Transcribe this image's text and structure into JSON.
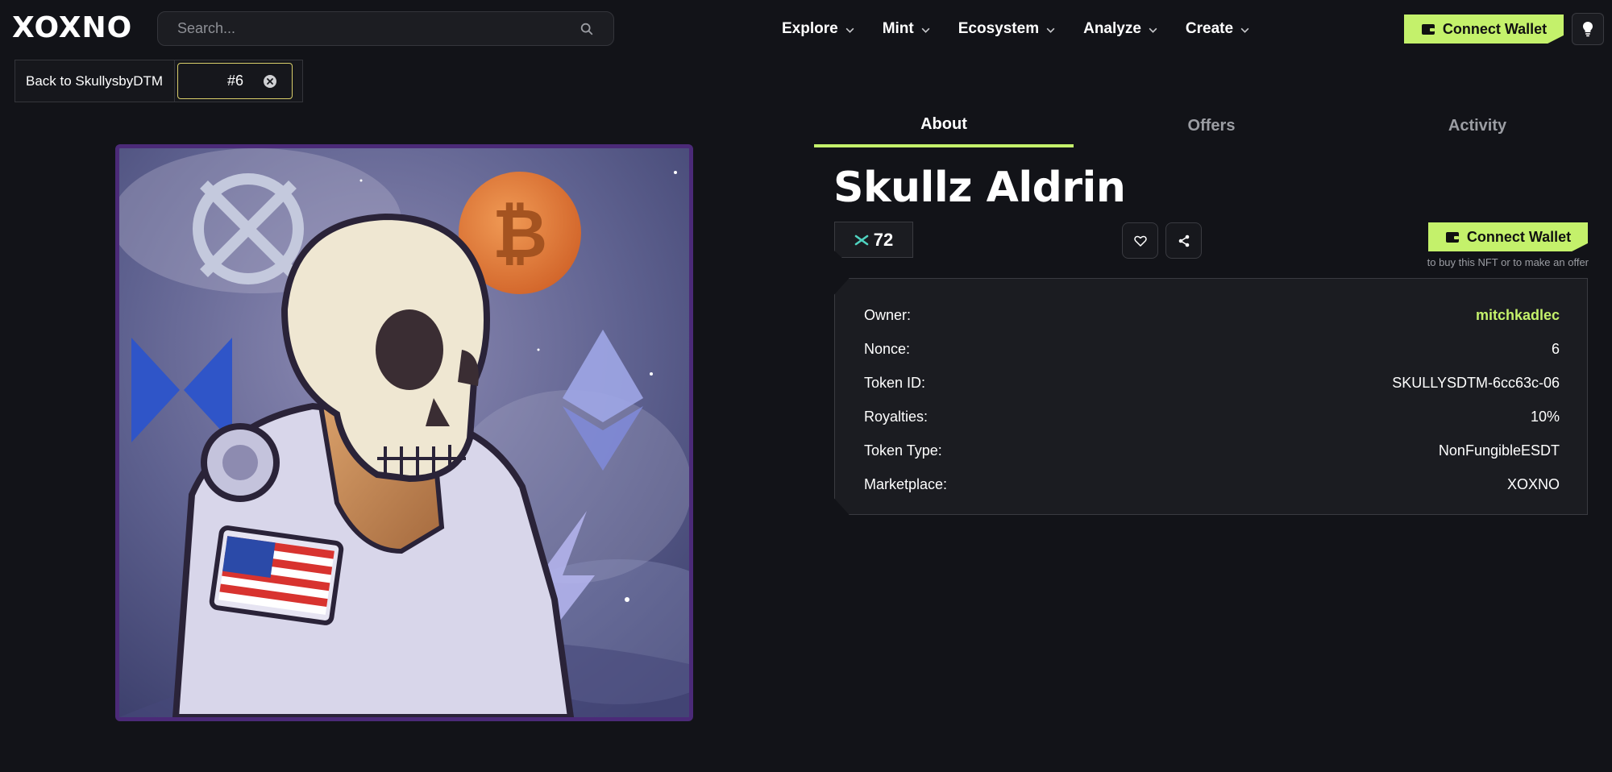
{
  "header": {
    "logo_text": "XOXNO",
    "search_placeholder": "Search...",
    "nav": [
      {
        "label": "Explore"
      },
      {
        "label": "Mint"
      },
      {
        "label": "Ecosystem"
      },
      {
        "label": "Analyze"
      },
      {
        "label": "Create"
      }
    ],
    "connect_label": "Connect Wallet"
  },
  "breadcrumb": {
    "back_label": "Back to SkullysbyDTM",
    "nonce_filter": "#6"
  },
  "tabs": [
    {
      "label": "About",
      "active": true
    },
    {
      "label": "Offers",
      "active": false
    },
    {
      "label": "Activity",
      "active": false
    }
  ],
  "nft": {
    "name": "Skullz Aldrin",
    "score": "72",
    "connect_label": "Connect Wallet",
    "buy_hint": "to buy this NFT or to make an offer"
  },
  "details": [
    {
      "key": "Owner:",
      "value": "mitchkadlec"
    },
    {
      "key": "Nonce:",
      "value": "6"
    },
    {
      "key": "Token ID:",
      "value": "SKULLYSDTM-6cc63c-06"
    },
    {
      "key": "Royalties:",
      "value": "10%"
    },
    {
      "key": "Token Type:",
      "value": "NonFungibleESDT"
    },
    {
      "key": "Marketplace:",
      "value": "XOXNO"
    }
  ],
  "colors": {
    "accent": "#c4f16b",
    "background": "#121318",
    "panel": "#1b1c21",
    "nft_border": "#4b2a78"
  }
}
